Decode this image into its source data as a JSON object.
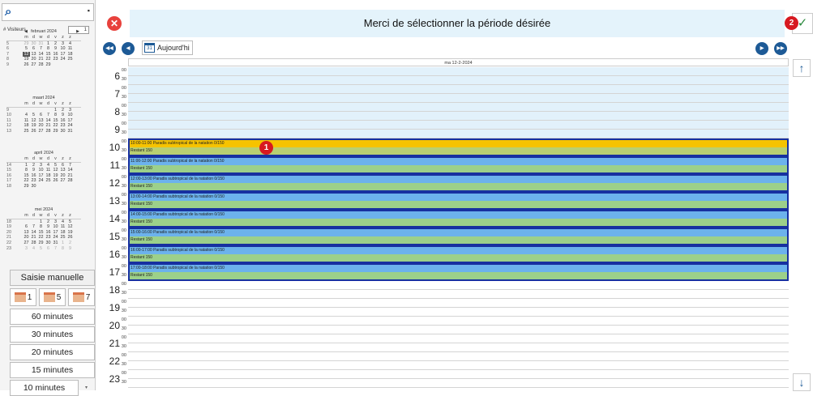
{
  "search": {
    "icon": "search-icon",
    "pin": "pin-icon"
  },
  "visitors": {
    "label": "# Visiteurs",
    "value": "1"
  },
  "calendars": [
    {
      "title": "februari 2024",
      "days_header": [
        "m",
        "d",
        "w",
        "d",
        "v",
        "z",
        "z"
      ],
      "weeks": [
        [
          "5",
          "29",
          "30",
          "31",
          "1",
          "2",
          "3",
          "4"
        ],
        [
          "6",
          "5",
          "6",
          "7",
          "8",
          "9",
          "10",
          "11"
        ],
        [
          "7",
          "12",
          "13",
          "14",
          "15",
          "16",
          "17",
          "18"
        ],
        [
          "8",
          "19",
          "20",
          "21",
          "22",
          "23",
          "24",
          "25"
        ],
        [
          "9",
          "26",
          "27",
          "28",
          "29",
          "",
          "",
          ""
        ]
      ]
    },
    {
      "title": "maart 2024",
      "days_header": [
        "m",
        "d",
        "w",
        "d",
        "v",
        "z",
        "z"
      ],
      "weeks": [
        [
          "9",
          "",
          "",
          "",
          "",
          "1",
          "2",
          "3"
        ],
        [
          "10",
          "4",
          "5",
          "6",
          "7",
          "8",
          "9",
          "10"
        ],
        [
          "11",
          "11",
          "12",
          "13",
          "14",
          "15",
          "16",
          "17"
        ],
        [
          "12",
          "18",
          "19",
          "20",
          "21",
          "22",
          "23",
          "24"
        ],
        [
          "13",
          "25",
          "26",
          "27",
          "28",
          "29",
          "30",
          "31"
        ]
      ]
    },
    {
      "title": "april 2024",
      "days_header": [
        "m",
        "d",
        "w",
        "d",
        "v",
        "z",
        "z"
      ],
      "weeks": [
        [
          "14",
          "1",
          "2",
          "3",
          "4",
          "5",
          "6",
          "7"
        ],
        [
          "15",
          "8",
          "9",
          "10",
          "11",
          "12",
          "13",
          "14"
        ],
        [
          "16",
          "15",
          "16",
          "17",
          "18",
          "19",
          "20",
          "21"
        ],
        [
          "17",
          "22",
          "23",
          "24",
          "25",
          "26",
          "27",
          "28"
        ],
        [
          "18",
          "29",
          "30",
          "",
          "",
          "",
          "",
          ""
        ]
      ]
    },
    {
      "title": "mei 2024",
      "days_header": [
        "m",
        "d",
        "w",
        "d",
        "v",
        "z",
        "z"
      ],
      "weeks": [
        [
          "18",
          "",
          "",
          "1",
          "2",
          "3",
          "4",
          "5"
        ],
        [
          "19",
          "6",
          "7",
          "8",
          "9",
          "10",
          "11",
          "12"
        ],
        [
          "20",
          "13",
          "14",
          "15",
          "16",
          "17",
          "18",
          "19"
        ],
        [
          "21",
          "20",
          "21",
          "22",
          "23",
          "24",
          "25",
          "26"
        ],
        [
          "22",
          "27",
          "28",
          "29",
          "30",
          "31",
          "1",
          "2"
        ],
        [
          "23",
          "3",
          "4",
          "5",
          "6",
          "7",
          "8",
          "9"
        ]
      ]
    }
  ],
  "manual_entry": "Saisie manuelle",
  "views": [
    "1",
    "5",
    "7"
  ],
  "durations": [
    "60 minutes",
    "30 minutes",
    "20 minutes",
    "15 minutes",
    "10 minutes"
  ],
  "header": {
    "title": "Merci de sélectionner la période désirée",
    "close_icon": "close-icon",
    "ok_icon": "check-icon",
    "ok_symbol": "✓",
    "close_symbol": "✕",
    "badge": "2"
  },
  "toolbar": {
    "today": "Aujourd'hi",
    "today_icon_day": "31"
  },
  "day_header": "ma 12-2-2024",
  "hours": [
    "6",
    "7",
    "8",
    "9",
    "10",
    "11",
    "12",
    "13",
    "14",
    "15",
    "16",
    "17",
    "18",
    "19",
    "20",
    "21",
    "22",
    "23"
  ],
  "minutes": [
    "00",
    "30"
  ],
  "events": [
    {
      "time": "10:00-11:00 Paradis subtropical de la natation 0/150",
      "rest": "Restant 150",
      "selected": true,
      "badge": "1"
    },
    {
      "time": "11:00-12:00 Paradis subtropical de la natation 0/150",
      "rest": "Restant 150"
    },
    {
      "time": "12:00-13:00 Paradis subtropical de la natation 0/150",
      "rest": "Restant 150"
    },
    {
      "time": "13:00-14:00 Paradis subtropical de la natation 0/150",
      "rest": "Restant 150"
    },
    {
      "time": "14:00-15:00 Paradis subtropical de la natation 0/150",
      "rest": "Restant 150"
    },
    {
      "time": "15:00-16:00 Paradis subtropical de la natation 0/150",
      "rest": "Restant 150"
    },
    {
      "time": "16:00-17:00 Paradis subtropical de la natation 0/150",
      "rest": "Restant 150"
    },
    {
      "time": "17:00-18:00 Paradis subtropical de la natation 0/150",
      "rest": "Restant 150"
    }
  ],
  "colors": {
    "accent": "#1d5a96",
    "selected_event": "#f6c300",
    "event_top": "#6cb2ec",
    "event_bottom": "#9cd08a",
    "badge": "#d71920"
  }
}
